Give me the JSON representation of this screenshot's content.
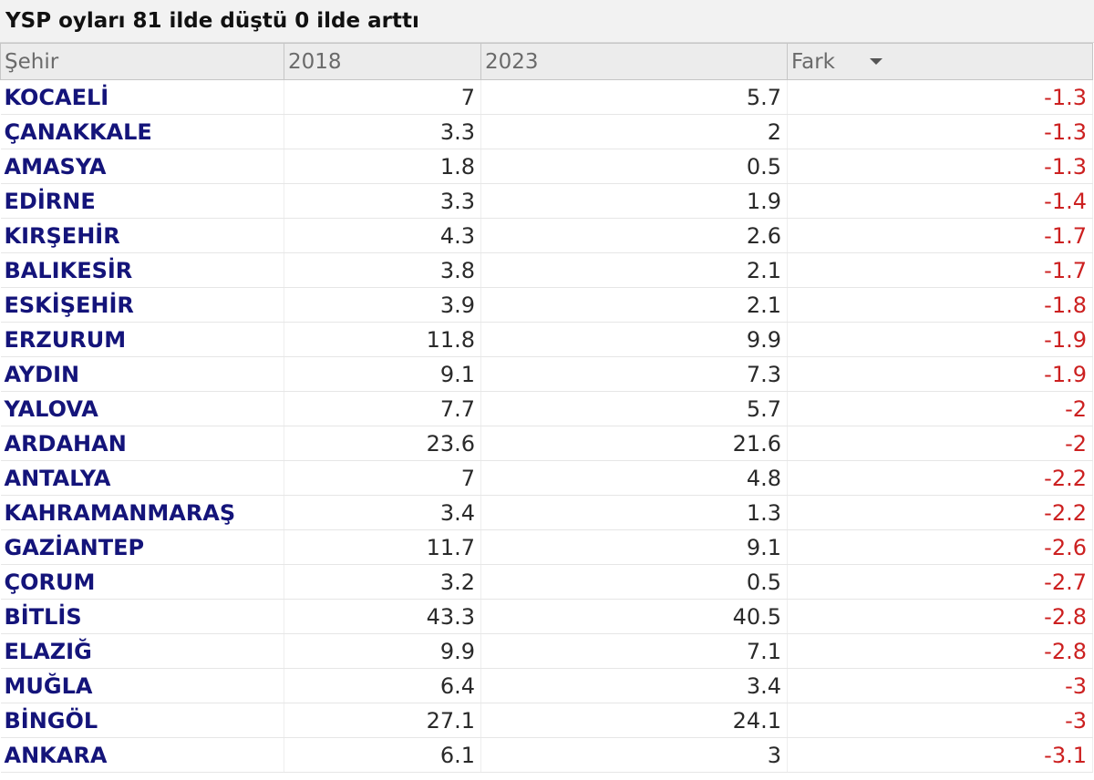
{
  "title": "YSP oyları 81 ilde düştü 0 ilde arttı",
  "columns": {
    "city": "Şehir",
    "y2018": "2018",
    "y2023": "2023",
    "diff": "Fark"
  },
  "sort": {
    "column": "diff",
    "direction": "descending",
    "icon": "sort-desc-arrow"
  },
  "colors": {
    "city_text": "#14147a",
    "diff_text": "#cc2020",
    "header_bg": "#ececec"
  },
  "rows": [
    {
      "city": "KOCAELİ",
      "y2018": "7",
      "y2023": "5.7",
      "diff": "-1.3"
    },
    {
      "city": "ÇANAKKALE",
      "y2018": "3.3",
      "y2023": "2",
      "diff": "-1.3"
    },
    {
      "city": "AMASYA",
      "y2018": "1.8",
      "y2023": "0.5",
      "diff": "-1.3"
    },
    {
      "city": "EDİRNE",
      "y2018": "3.3",
      "y2023": "1.9",
      "diff": "-1.4"
    },
    {
      "city": "KIRŞEHİR",
      "y2018": "4.3",
      "y2023": "2.6",
      "diff": "-1.7"
    },
    {
      "city": "BALIKESİR",
      "y2018": "3.8",
      "y2023": "2.1",
      "diff": "-1.7"
    },
    {
      "city": "ESKİŞEHİR",
      "y2018": "3.9",
      "y2023": "2.1",
      "diff": "-1.8"
    },
    {
      "city": "ERZURUM",
      "y2018": "11.8",
      "y2023": "9.9",
      "diff": "-1.9"
    },
    {
      "city": "AYDIN",
      "y2018": "9.1",
      "y2023": "7.3",
      "diff": "-1.9"
    },
    {
      "city": "YALOVA",
      "y2018": "7.7",
      "y2023": "5.7",
      "diff": "-2"
    },
    {
      "city": "ARDAHAN",
      "y2018": "23.6",
      "y2023": "21.6",
      "diff": "-2"
    },
    {
      "city": "ANTALYA",
      "y2018": "7",
      "y2023": "4.8",
      "diff": "-2.2"
    },
    {
      "city": "KAHRAMANMARAŞ",
      "y2018": "3.4",
      "y2023": "1.3",
      "diff": "-2.2"
    },
    {
      "city": "GAZİANTEP",
      "y2018": "11.7",
      "y2023": "9.1",
      "diff": "-2.6"
    },
    {
      "city": "ÇORUM",
      "y2018": "3.2",
      "y2023": "0.5",
      "diff": "-2.7"
    },
    {
      "city": "BİTLİS",
      "y2018": "43.3",
      "y2023": "40.5",
      "diff": "-2.8"
    },
    {
      "city": "ELAZIĞ",
      "y2018": "9.9",
      "y2023": "7.1",
      "diff": "-2.8"
    },
    {
      "city": "MUĞLA",
      "y2018": "6.4",
      "y2023": "3.4",
      "diff": "-3"
    },
    {
      "city": "BİNGÖL",
      "y2018": "27.1",
      "y2023": "24.1",
      "diff": "-3"
    },
    {
      "city": "ANKARA",
      "y2018": "6.1",
      "y2023": "3",
      "diff": "-3.1"
    }
  ]
}
